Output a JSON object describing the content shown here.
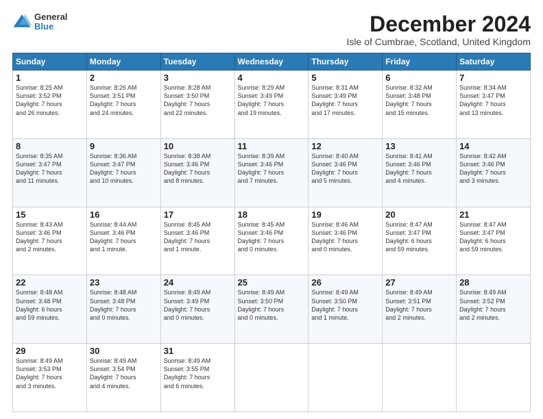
{
  "logo": {
    "general": "General",
    "blue": "Blue"
  },
  "title": "December 2024",
  "location": "Isle of Cumbrae, Scotland, United Kingdom",
  "days_header": [
    "Sunday",
    "Monday",
    "Tuesday",
    "Wednesday",
    "Thursday",
    "Friday",
    "Saturday"
  ],
  "weeks": [
    [
      {
        "day": "1",
        "text": "Sunrise: 8:25 AM\nSunset: 3:52 PM\nDaylight: 7 hours\nand 26 minutes."
      },
      {
        "day": "2",
        "text": "Sunrise: 8:26 AM\nSunset: 3:51 PM\nDaylight: 7 hours\nand 24 minutes."
      },
      {
        "day": "3",
        "text": "Sunrise: 8:28 AM\nSunset: 3:50 PM\nDaylight: 7 hours\nand 22 minutes."
      },
      {
        "day": "4",
        "text": "Sunrise: 8:29 AM\nSunset: 3:49 PM\nDaylight: 7 hours\nand 19 minutes."
      },
      {
        "day": "5",
        "text": "Sunrise: 8:31 AM\nSunset: 3:49 PM\nDaylight: 7 hours\nand 17 minutes."
      },
      {
        "day": "6",
        "text": "Sunrise: 8:32 AM\nSunset: 3:48 PM\nDaylight: 7 hours\nand 15 minutes."
      },
      {
        "day": "7",
        "text": "Sunrise: 8:34 AM\nSunset: 3:47 PM\nDaylight: 7 hours\nand 13 minutes."
      }
    ],
    [
      {
        "day": "8",
        "text": "Sunrise: 8:35 AM\nSunset: 3:47 PM\nDaylight: 7 hours\nand 11 minutes."
      },
      {
        "day": "9",
        "text": "Sunrise: 8:36 AM\nSunset: 3:47 PM\nDaylight: 7 hours\nand 10 minutes."
      },
      {
        "day": "10",
        "text": "Sunrise: 8:38 AM\nSunset: 3:46 PM\nDaylight: 7 hours\nand 8 minutes."
      },
      {
        "day": "11",
        "text": "Sunrise: 8:39 AM\nSunset: 3:46 PM\nDaylight: 7 hours\nand 7 minutes."
      },
      {
        "day": "12",
        "text": "Sunrise: 8:40 AM\nSunset: 3:46 PM\nDaylight: 7 hours\nand 5 minutes."
      },
      {
        "day": "13",
        "text": "Sunrise: 8:41 AM\nSunset: 3:46 PM\nDaylight: 7 hours\nand 4 minutes."
      },
      {
        "day": "14",
        "text": "Sunrise: 8:42 AM\nSunset: 3:46 PM\nDaylight: 7 hours\nand 3 minutes."
      }
    ],
    [
      {
        "day": "15",
        "text": "Sunrise: 8:43 AM\nSunset: 3:46 PM\nDaylight: 7 hours\nand 2 minutes."
      },
      {
        "day": "16",
        "text": "Sunrise: 8:44 AM\nSunset: 3:46 PM\nDaylight: 7 hours\nand 1 minute."
      },
      {
        "day": "17",
        "text": "Sunrise: 8:45 AM\nSunset: 3:46 PM\nDaylight: 7 hours\nand 1 minute."
      },
      {
        "day": "18",
        "text": "Sunrise: 8:45 AM\nSunset: 3:46 PM\nDaylight: 7 hours\nand 0 minutes."
      },
      {
        "day": "19",
        "text": "Sunrise: 8:46 AM\nSunset: 3:46 PM\nDaylight: 7 hours\nand 0 minutes."
      },
      {
        "day": "20",
        "text": "Sunrise: 8:47 AM\nSunset: 3:47 PM\nDaylight: 6 hours\nand 59 minutes."
      },
      {
        "day": "21",
        "text": "Sunrise: 8:47 AM\nSunset: 3:47 PM\nDaylight: 6 hours\nand 59 minutes."
      }
    ],
    [
      {
        "day": "22",
        "text": "Sunrise: 8:48 AM\nSunset: 3:48 PM\nDaylight: 6 hours\nand 59 minutes."
      },
      {
        "day": "23",
        "text": "Sunrise: 8:48 AM\nSunset: 3:48 PM\nDaylight: 7 hours\nand 0 minutes."
      },
      {
        "day": "24",
        "text": "Sunrise: 8:49 AM\nSunset: 3:49 PM\nDaylight: 7 hours\nand 0 minutes."
      },
      {
        "day": "25",
        "text": "Sunrise: 8:49 AM\nSunset: 3:50 PM\nDaylight: 7 hours\nand 0 minutes."
      },
      {
        "day": "26",
        "text": "Sunrise: 8:49 AM\nSunset: 3:50 PM\nDaylight: 7 hours\nand 1 minute."
      },
      {
        "day": "27",
        "text": "Sunrise: 8:49 AM\nSunset: 3:51 PM\nDaylight: 7 hours\nand 2 minutes."
      },
      {
        "day": "28",
        "text": "Sunrise: 8:49 AM\nSunset: 3:52 PM\nDaylight: 7 hours\nand 2 minutes."
      }
    ],
    [
      {
        "day": "29",
        "text": "Sunrise: 8:49 AM\nSunset: 3:53 PM\nDaylight: 7 hours\nand 3 minutes."
      },
      {
        "day": "30",
        "text": "Sunrise: 8:49 AM\nSunset: 3:54 PM\nDaylight: 7 hours\nand 4 minutes."
      },
      {
        "day": "31",
        "text": "Sunrise: 8:49 AM\nSunset: 3:55 PM\nDaylight: 7 hours\nand 6 minutes."
      },
      null,
      null,
      null,
      null
    ]
  ]
}
